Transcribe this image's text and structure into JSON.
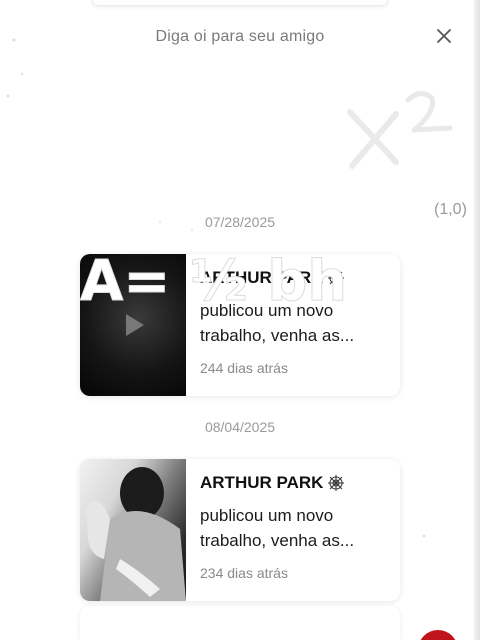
{
  "header": {
    "title": "Diga oi para seu amigo"
  },
  "messages": [
    {
      "date": "07/28/2025",
      "name": "ARTHUR PARK",
      "text": "publicou um novo trabalho, venha as...",
      "time_ago": "244 dias atrás",
      "thumbnail_icon": "play-icon"
    },
    {
      "date": "08/04/2025",
      "name": "ARTHUR PARK",
      "text": "publicou um novo trabalho, venha as...",
      "time_ago": "234 dias atrás",
      "thumbnail_icon": "none"
    }
  ],
  "doodles": {
    "formula": "A= ½ bh",
    "power": "x²",
    "coord": "(1,0)"
  },
  "colors": {
    "badge": "#c0141c",
    "muted_text": "#9a9a9a"
  }
}
